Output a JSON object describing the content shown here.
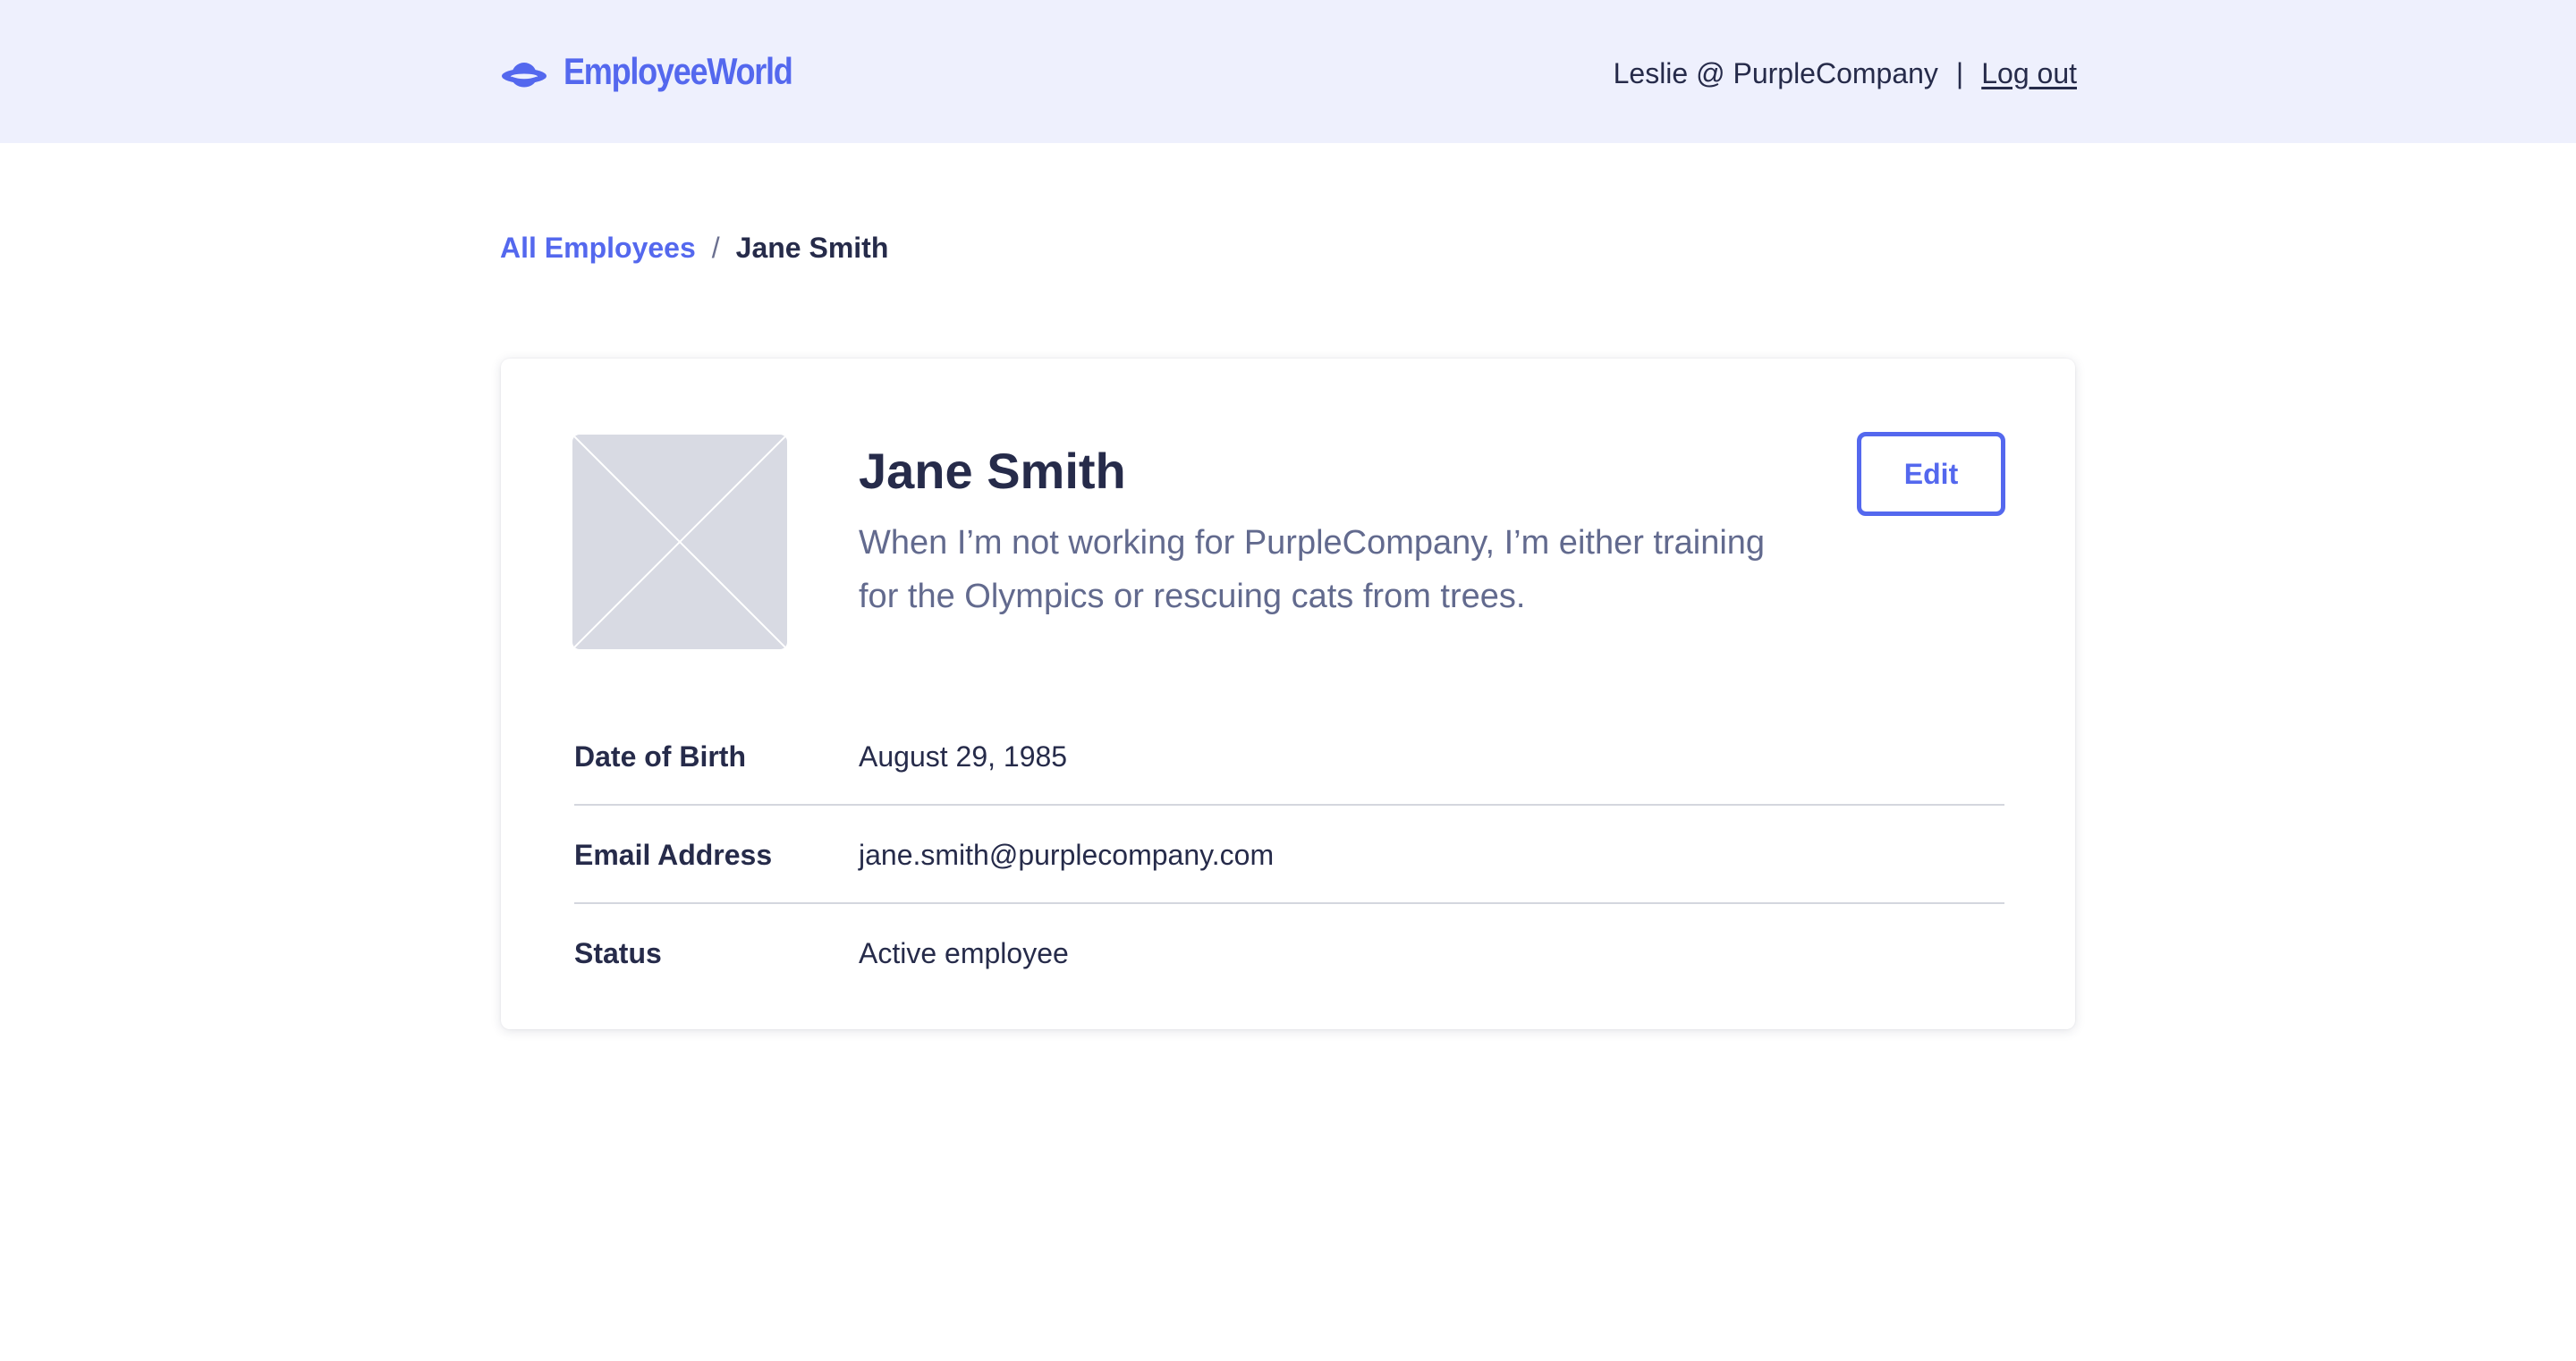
{
  "header": {
    "app_name": "EmployeeWorld",
    "logo_icon": "planet-icon",
    "user_label": "Leslie @ PurpleCompany",
    "separator": "|",
    "logout_label": "Log out"
  },
  "breadcrumb": {
    "parent_label": "All Employees",
    "separator": "/",
    "current_label": "Jane Smith"
  },
  "profile": {
    "photo_icon": "image-placeholder-icon",
    "name": "Jane Smith",
    "bio": "When I’m not working for PurpleCompany, I’m either training for the Olympics or rescuing cats from trees.",
    "edit_label": "Edit"
  },
  "details": [
    {
      "label": "Date of Birth",
      "value": "August 29, 1985"
    },
    {
      "label": "Email Address",
      "value": "jane.smith@purplecompany.com"
    },
    {
      "label": "Status",
      "value": "Active employee"
    }
  ],
  "colors": {
    "accent": "#5468ee",
    "header_background": "#eef0fd",
    "text_primary": "#262b4a",
    "text_secondary": "#626a8e",
    "placeholder": "#d8dae3",
    "divider": "#d4d6de"
  }
}
